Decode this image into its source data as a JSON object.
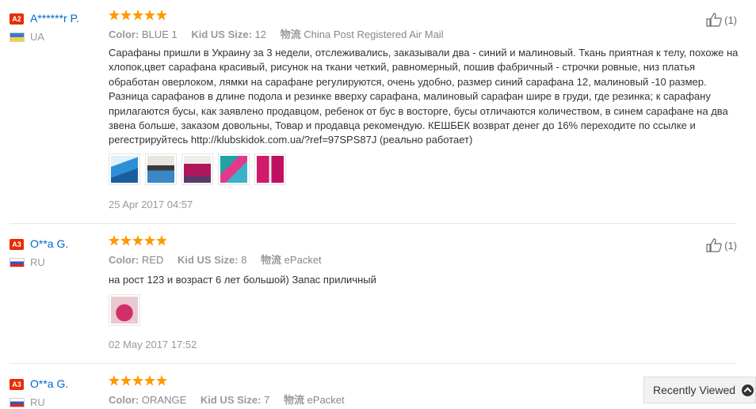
{
  "reviews": [
    {
      "level": "A2",
      "user": "A******r P.",
      "country": "UA",
      "color_label": "Color:",
      "color": "BLUE 1",
      "size_label": "Kid US Size:",
      "size": "12",
      "shipping_label": "物流",
      "shipping": "China Post Registered Air Mail",
      "text": "Сарафаны пришли в Украину за 3 недели, отслеживались, заказывали два - синий и малиновый. Ткань приятная к телу, похоже на хлопок,цвет сарафана красивый, рисунок на ткани четкий, равномерный, пошив фабричный - строчки ровные, низ платья обработан оверлоком, лямки на сарафане регулируются, очень удобно, размер синий сарафана 12, малиновый -10 размер. Разница сарафанов в длине подола и резинке вверху сарафана, малиновый сарафан шире в груди, где резинка; к сарафану прилагаются бусы, как заявлено продавцом, ребенок от бус в восторге, бусы отличаются количеством, в синем сарафане на два звена больше, заказом довольны, Товар и продавца рекомендую. КЕШБЕК возврат денег до 16% переходите по ссылке и регестрируйтесь http://klubskidok.com.ua/?ref=97SPS87J (реально работает)",
      "date": "25 Apr 2017 04:57",
      "helpful": "(1)",
      "photos": 5,
      "rating": 5
    },
    {
      "level": "A3",
      "user": "O**a G.",
      "country": "RU",
      "color_label": "Color:",
      "color": "RED",
      "size_label": "Kid US Size:",
      "size": "8",
      "shipping_label": "物流",
      "shipping": "ePacket",
      "text": "на рост 123 и возраст 6 лет большой) Запас приличный",
      "date": "02 May 2017 17:52",
      "helpful": "(1)",
      "photos": 1,
      "rating": 5
    },
    {
      "level": "A3",
      "user": "O**a G.",
      "country": "RU",
      "color_label": "Color:",
      "color": "ORANGE",
      "size_label": "Kid US Size:",
      "size": "7",
      "shipping_label": "物流",
      "shipping": "ePacket",
      "rating": 5
    }
  ],
  "recently_viewed": "Recently Viewed",
  "colors": {
    "accent_star": "#ff9900",
    "badge": "#e62e04",
    "link": "#0066cc"
  }
}
